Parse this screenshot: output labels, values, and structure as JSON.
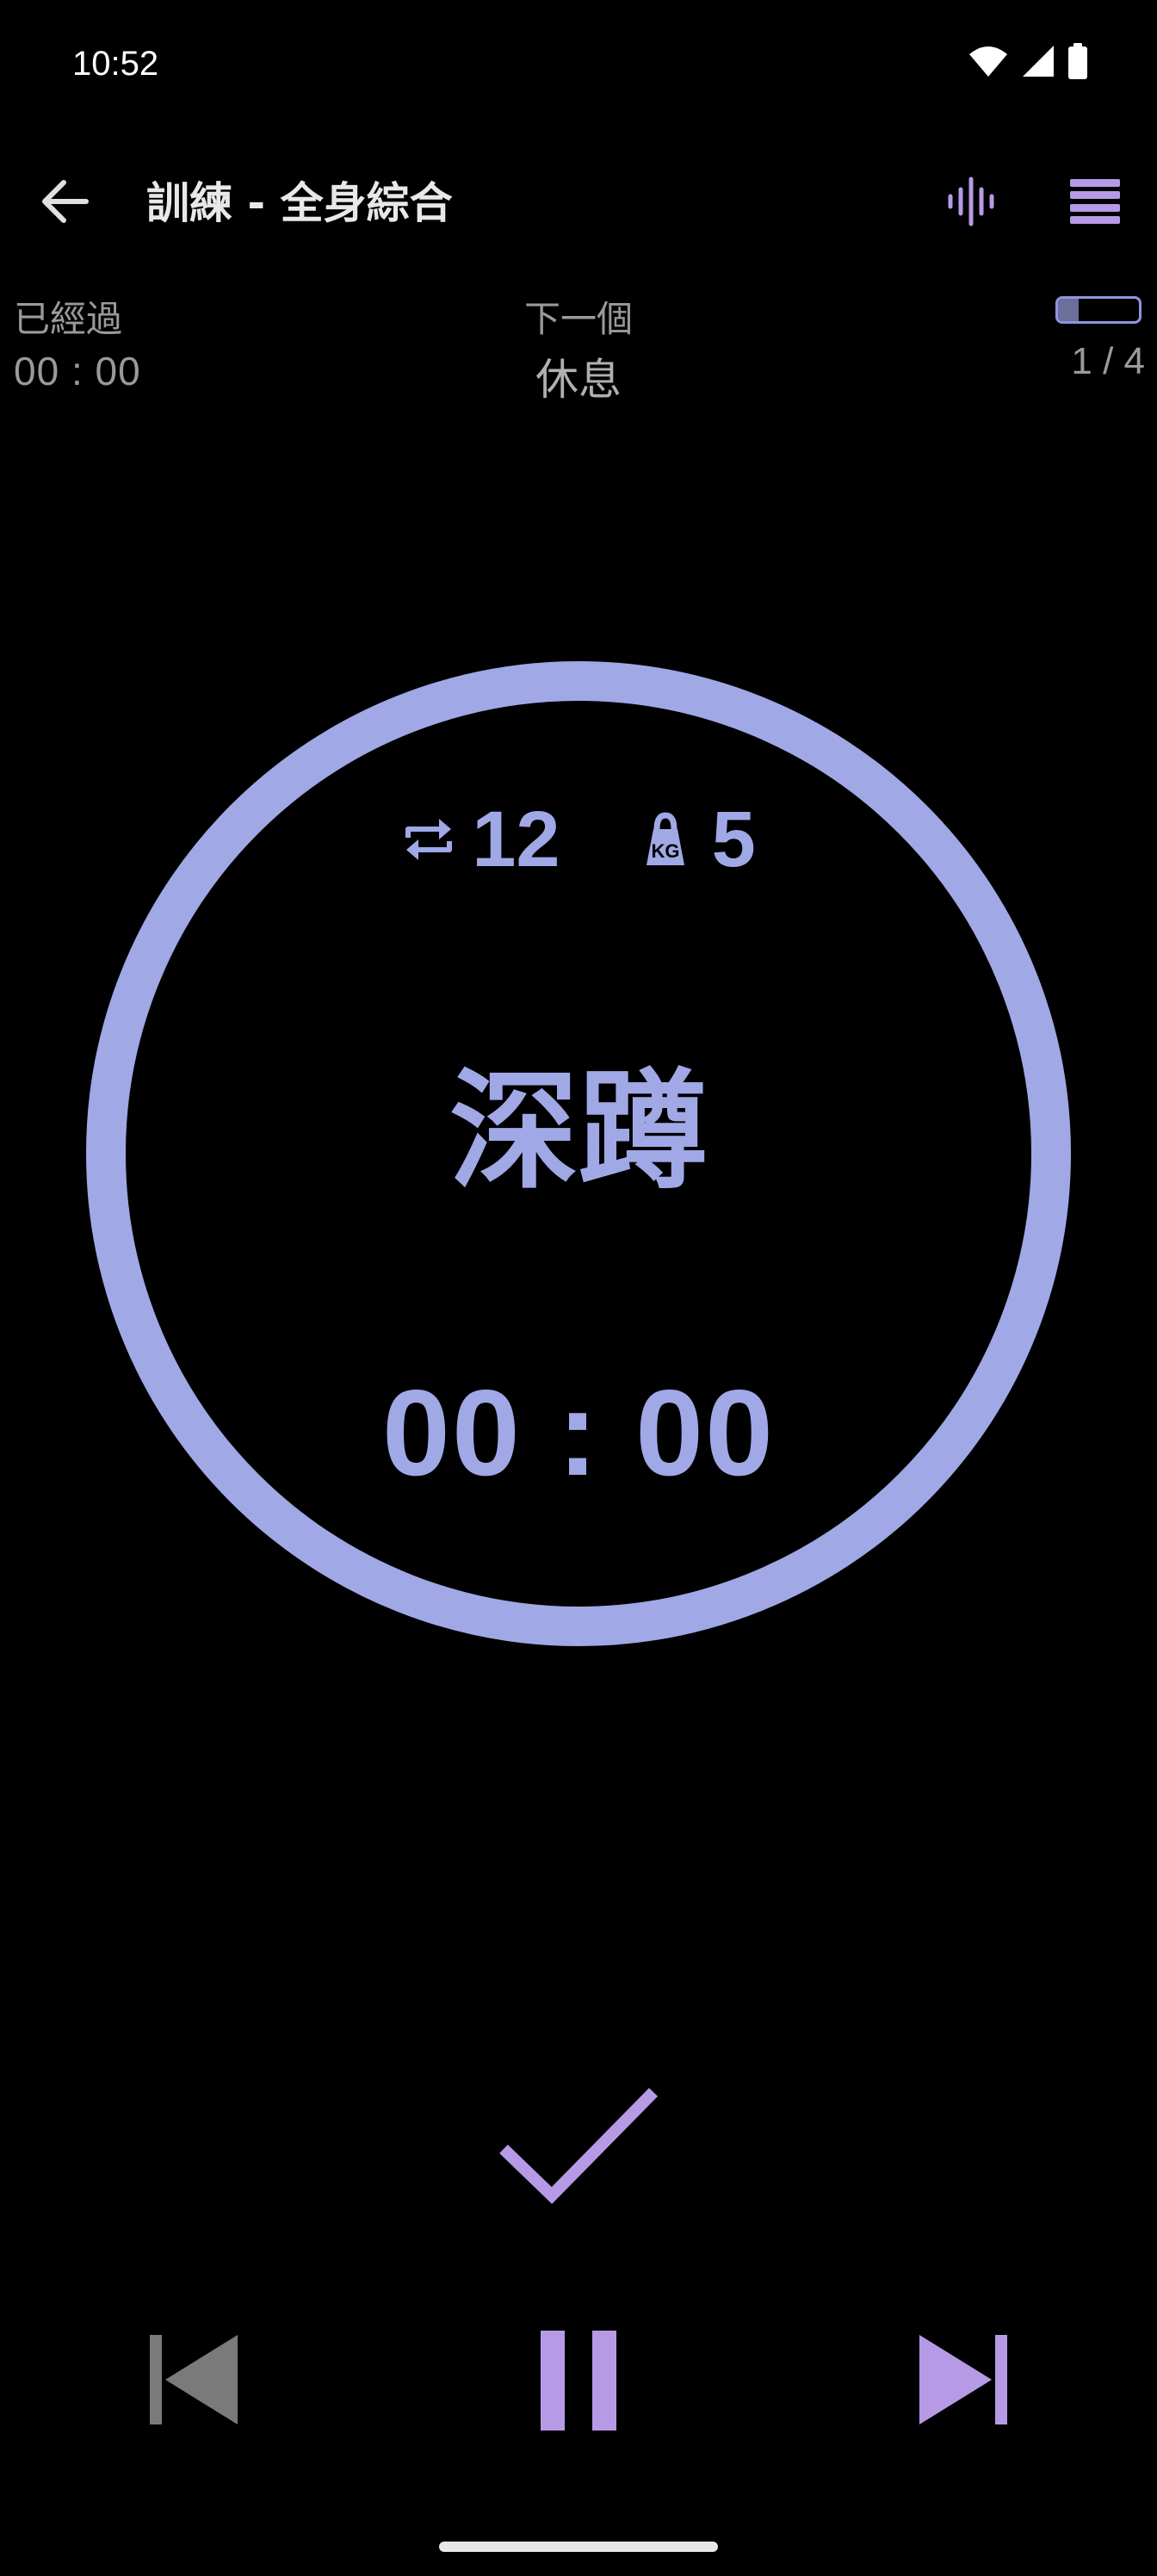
{
  "status_bar": {
    "time": "10:52",
    "icons": [
      "wifi-icon",
      "signal-icon",
      "battery-icon"
    ]
  },
  "app_bar": {
    "title": "訓練 - 全身綜合",
    "actions": [
      "back-arrow-icon",
      "sound-wave-icon",
      "menu-list-icon"
    ]
  },
  "info": {
    "elapsed_label": "已經過",
    "elapsed_value": "00 : 00",
    "next_label": "下一個",
    "next_value": "休息",
    "progress_text": "1 / 4",
    "progress_fraction": 0.25
  },
  "exercise": {
    "reps": "12",
    "weight": "5",
    "reps_icon": "repeat-icon",
    "weight_icon": "kettlebell-kg-icon",
    "name": "深蹲",
    "timer": "00 : 00"
  },
  "controls": {
    "complete_icon": "check-icon",
    "previous_icon": "skip-previous-icon",
    "pause_icon": "pause-icon",
    "next_icon": "skip-next-icon"
  },
  "colors": {
    "accent": "#a0a8e6",
    "accent_purple": "#b79ae6",
    "muted_gray": "#9a9a9a",
    "background": "#000000"
  }
}
